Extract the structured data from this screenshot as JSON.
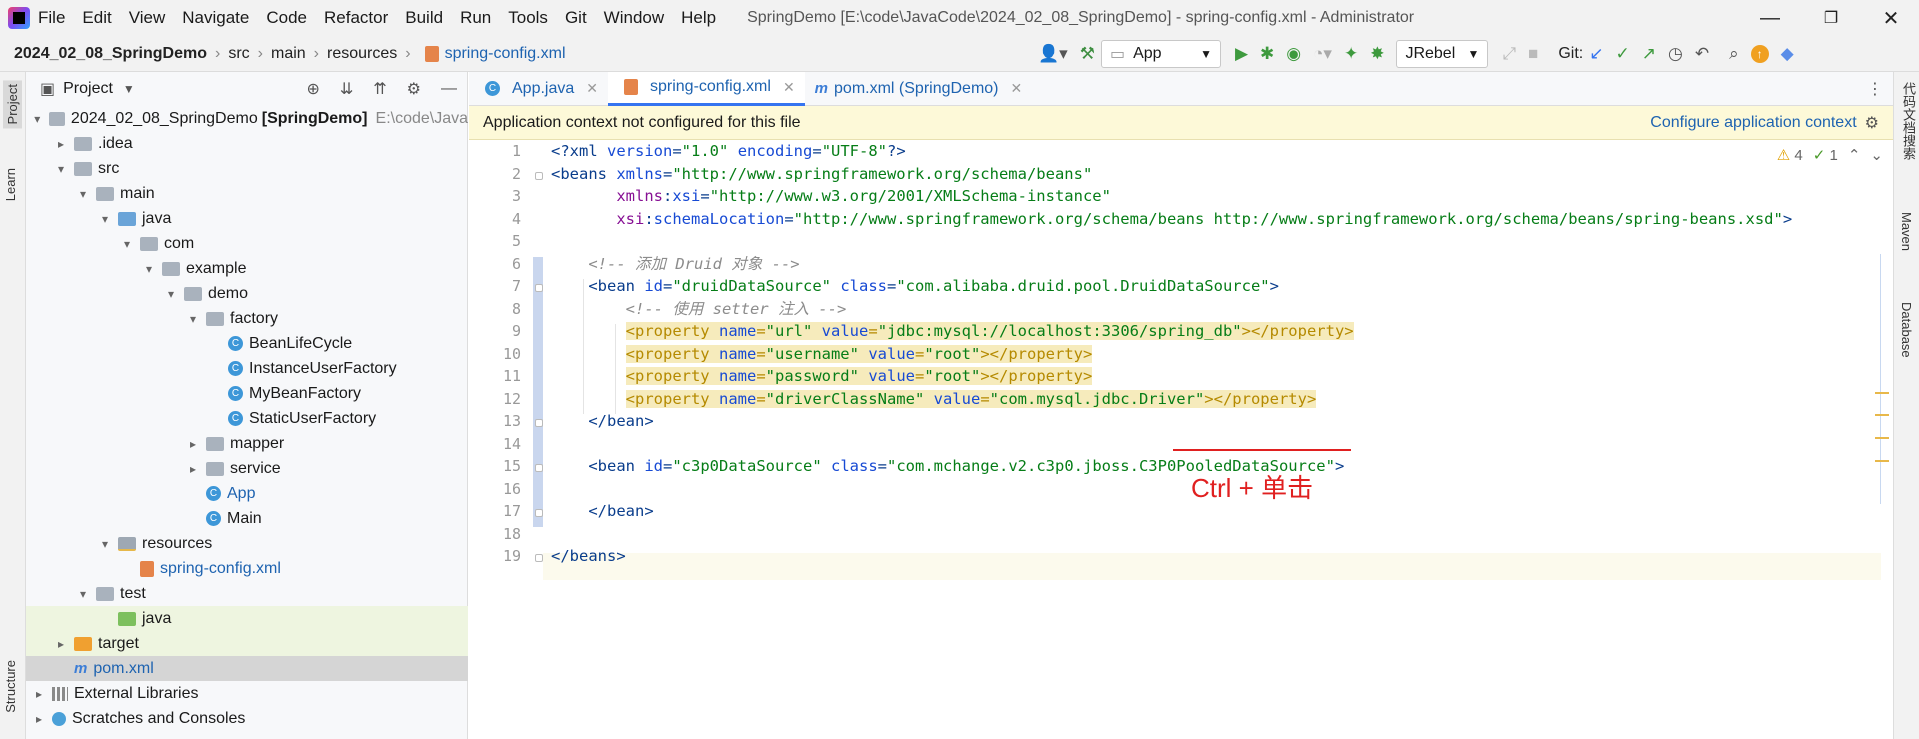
{
  "app": {
    "window_title": "SpringDemo [E:\\code\\JavaCode\\2024_02_08_SpringDemo] - spring-config.xml - Administrator",
    "menu": [
      "File",
      "Edit",
      "View",
      "Navigate",
      "Code",
      "Refactor",
      "Build",
      "Run",
      "Tools",
      "Git",
      "Window",
      "Help"
    ],
    "window_controls": {
      "minimize": "—",
      "restore": "❐",
      "close": "✕"
    }
  },
  "navbar": {
    "breadcrumb": [
      "2024_02_08_SpringDemo",
      "src",
      "main",
      "resources",
      "spring-config.xml"
    ],
    "run_config": "App",
    "jrebel": "JRebel",
    "git_label": "Git:"
  },
  "left_strip": {
    "project": "Project",
    "learn": "Learn",
    "structure": "Structure"
  },
  "right_strip": {
    "plugin": "代码文档搜索",
    "maven": "Maven",
    "database": "Database"
  },
  "project_panel": {
    "title": "Project",
    "tree": [
      {
        "label": "2024_02_08_SpringDemo",
        "bold_suffix": "[SpringDemo]",
        "muted": "E:\\code\\Java",
        "depth": 0,
        "arrow": "▾",
        "icon": "folder"
      },
      {
        "label": ".idea",
        "depth": 1,
        "arrow": "▸",
        "icon": "folder"
      },
      {
        "label": "src",
        "depth": 1,
        "arrow": "▾",
        "icon": "folder"
      },
      {
        "label": "main",
        "depth": 2,
        "arrow": "▾",
        "icon": "folder"
      },
      {
        "label": "java",
        "depth": 3,
        "arrow": "▾",
        "icon": "folder-blue"
      },
      {
        "label": "com",
        "depth": 4,
        "arrow": "▾",
        "icon": "folder"
      },
      {
        "label": "example",
        "depth": 5,
        "arrow": "▾",
        "icon": "folder"
      },
      {
        "label": "demo",
        "depth": 6,
        "arrow": "▾",
        "icon": "folder"
      },
      {
        "label": "factory",
        "depth": 7,
        "arrow": "▾",
        "icon": "folder"
      },
      {
        "label": "BeanLifeCycle",
        "depth": 8,
        "arrow": "",
        "icon": "class"
      },
      {
        "label": "InstanceUserFactory",
        "depth": 8,
        "arrow": "",
        "icon": "class"
      },
      {
        "label": "MyBeanFactory",
        "depth": 8,
        "arrow": "",
        "icon": "class"
      },
      {
        "label": "StaticUserFactory",
        "depth": 8,
        "arrow": "",
        "icon": "class"
      },
      {
        "label": "mapper",
        "depth": 7,
        "arrow": "▸",
        "icon": "folder"
      },
      {
        "label": "service",
        "depth": 7,
        "arrow": "▸",
        "icon": "folder"
      },
      {
        "label": "App",
        "depth": 7,
        "arrow": "",
        "icon": "class-run",
        "blue": true
      },
      {
        "label": "Main",
        "depth": 7,
        "arrow": "",
        "icon": "class-run"
      },
      {
        "label": "resources",
        "depth": 3,
        "arrow": "▾",
        "icon": "folder-res"
      },
      {
        "label": "spring-config.xml",
        "depth": 4,
        "arrow": "",
        "icon": "xml",
        "blue": true
      },
      {
        "label": "test",
        "depth": 2,
        "arrow": "▾",
        "icon": "folder"
      },
      {
        "label": "java",
        "depth": 3,
        "arrow": "",
        "icon": "folder-green",
        "hl": "green"
      },
      {
        "label": "target",
        "depth": 1,
        "arrow": "▸",
        "icon": "folder-orange",
        "hl": "green"
      },
      {
        "label": "pom.xml",
        "depth": 1,
        "arrow": "",
        "icon": "maven",
        "hl": "sel",
        "blue": true
      },
      {
        "label": "External Libraries",
        "depth": 0,
        "arrow": "▸",
        "icon": "lib"
      },
      {
        "label": "Scratches and Consoles",
        "depth": 0,
        "arrow": "▸",
        "icon": "scratch"
      }
    ]
  },
  "tabs": [
    {
      "label": "App.java",
      "icon": "C",
      "active": false
    },
    {
      "label": "spring-config.xml",
      "icon": "xml",
      "active": true
    },
    {
      "label": "pom.xml (SpringDemo)",
      "icon": "m",
      "active": false
    }
  ],
  "notice": {
    "text": "Application context not configured for this file",
    "action": "Configure application context"
  },
  "annotations": {
    "warnings": "4",
    "checks": "1"
  },
  "editor": {
    "line_numbers": [
      "1",
      "2",
      "3",
      "4",
      "5",
      "6",
      "7",
      "8",
      "9",
      "10",
      "11",
      "12",
      "13",
      "14",
      "15",
      "16",
      "17",
      "18",
      "19"
    ],
    "lines": [
      [
        {
          "c": "t",
          "s": "<?xml "
        },
        {
          "c": "a",
          "s": "version"
        },
        {
          "c": "t",
          "s": "="
        },
        {
          "c": "v",
          "s": "\"1.0\""
        },
        {
          "c": "t",
          "s": " "
        },
        {
          "c": "a",
          "s": "encoding"
        },
        {
          "c": "t",
          "s": "="
        },
        {
          "c": "v",
          "s": "\"UTF-8\""
        },
        {
          "c": "t",
          "s": "?>"
        }
      ],
      [
        {
          "c": "t",
          "s": "<beans "
        },
        {
          "c": "a",
          "s": "xmlns"
        },
        {
          "c": "t",
          "s": "="
        },
        {
          "c": "v",
          "s": "\"http://www.springframework.org/schema/beans\""
        }
      ],
      [
        {
          "c": "t",
          "s": "       "
        },
        {
          "c": "ns",
          "s": "xmlns"
        },
        {
          "c": "t",
          "s": ":"
        },
        {
          "c": "a",
          "s": "xsi"
        },
        {
          "c": "t",
          "s": "="
        },
        {
          "c": "v",
          "s": "\"http://www.w3.org/2001/XMLSchema-instance\""
        }
      ],
      [
        {
          "c": "t",
          "s": "       "
        },
        {
          "c": "ns",
          "s": "xsi"
        },
        {
          "c": "t",
          "s": ":"
        },
        {
          "c": "a",
          "s": "schemaLocation"
        },
        {
          "c": "t",
          "s": "="
        },
        {
          "c": "v",
          "s": "\"http://www.springframework.org/schema/beans http://www.springframework.org/schema/beans/spring-beans.xsd\""
        },
        {
          "c": "t",
          "s": ">"
        }
      ],
      [],
      [
        {
          "c": "t",
          "s": "    "
        },
        {
          "c": "c",
          "s": "<!-- 添加 Druid 对象 -->"
        }
      ],
      [
        {
          "c": "t",
          "s": "    <bean "
        },
        {
          "c": "a",
          "s": "id"
        },
        {
          "c": "t",
          "s": "="
        },
        {
          "c": "v",
          "s": "\"druidDataSource\""
        },
        {
          "c": "t",
          "s": " "
        },
        {
          "c": "a",
          "s": "class"
        },
        {
          "c": "t",
          "s": "="
        },
        {
          "c": "v",
          "s": "\"com.alibaba.druid.pool.DruidDataSource\""
        },
        {
          "c": "t",
          "s": ">"
        }
      ],
      [
        {
          "c": "t",
          "s": "        "
        },
        {
          "c": "c",
          "s": "<!-- 使用 setter 注入 -->"
        }
      ],
      [
        {
          "c": "t",
          "s": "        "
        },
        {
          "c": "p",
          "s": "<property "
        },
        {
          "c": "pa",
          "s": "name"
        },
        {
          "c": "p",
          "s": "="
        },
        {
          "c": "pv",
          "s": "\"url\""
        },
        {
          "c": "p",
          "s": " "
        },
        {
          "c": "pa",
          "s": "value"
        },
        {
          "c": "p",
          "s": "="
        },
        {
          "c": "pv",
          "s": "\"jdbc:mysql://localhost:3306/spring_db\""
        },
        {
          "c": "p",
          "s": "></property>"
        }
      ],
      [
        {
          "c": "t",
          "s": "        "
        },
        {
          "c": "p",
          "s": "<property "
        },
        {
          "c": "pa",
          "s": "name"
        },
        {
          "c": "p",
          "s": "="
        },
        {
          "c": "pv",
          "s": "\"username\""
        },
        {
          "c": "p",
          "s": " "
        },
        {
          "c": "pa",
          "s": "value"
        },
        {
          "c": "p",
          "s": "="
        },
        {
          "c": "pv",
          "s": "\"root\""
        },
        {
          "c": "p",
          "s": "></property>"
        }
      ],
      [
        {
          "c": "t",
          "s": "        "
        },
        {
          "c": "p",
          "s": "<property "
        },
        {
          "c": "pa",
          "s": "name"
        },
        {
          "c": "p",
          "s": "="
        },
        {
          "c": "pv",
          "s": "\"password\""
        },
        {
          "c": "p",
          "s": " "
        },
        {
          "c": "pa",
          "s": "value"
        },
        {
          "c": "p",
          "s": "="
        },
        {
          "c": "pv",
          "s": "\"root\""
        },
        {
          "c": "p",
          "s": "></property>"
        }
      ],
      [
        {
          "c": "t",
          "s": "        "
        },
        {
          "c": "p",
          "s": "<property "
        },
        {
          "c": "pa",
          "s": "name"
        },
        {
          "c": "p",
          "s": "="
        },
        {
          "c": "pv",
          "s": "\"driverClassName\""
        },
        {
          "c": "p",
          "s": " "
        },
        {
          "c": "pa",
          "s": "value"
        },
        {
          "c": "p",
          "s": "="
        },
        {
          "c": "pv",
          "s": "\"com.mysql.jdbc.Driver\""
        },
        {
          "c": "p",
          "s": "></property>"
        }
      ],
      [
        {
          "c": "t",
          "s": "    </bean>"
        }
      ],
      [],
      [
        {
          "c": "t",
          "s": "    <bean "
        },
        {
          "c": "a",
          "s": "id"
        },
        {
          "c": "t",
          "s": "="
        },
        {
          "c": "v",
          "s": "\"c3p0DataSource\""
        },
        {
          "c": "t",
          "s": " "
        },
        {
          "c": "a",
          "s": "class"
        },
        {
          "c": "t",
          "s": "="
        },
        {
          "c": "v",
          "s": "\"com.mchange.v2.c3p0.jboss.C3P0PooledDataSource\""
        },
        {
          "c": "t",
          "s": ">"
        }
      ],
      [],
      [
        {
          "c": "t",
          "s": "    </bean>"
        }
      ],
      [],
      [
        {
          "c": "t",
          "s": "</beans>"
        }
      ]
    ],
    "current_line": "16",
    "hint_text": "Ctrl + 单击"
  }
}
